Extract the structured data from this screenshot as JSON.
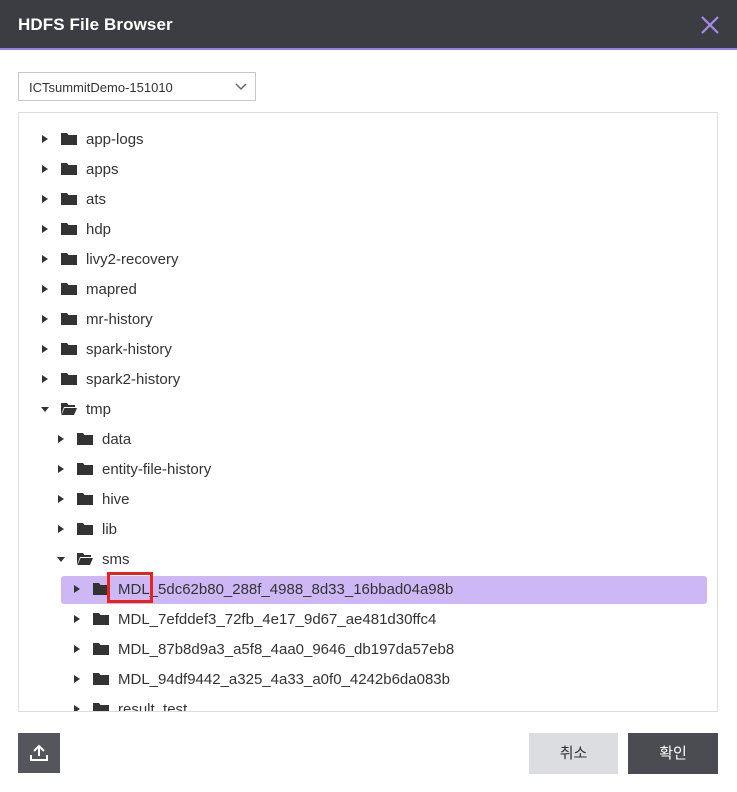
{
  "window": {
    "title": "HDFS File Browser"
  },
  "cluster_select": {
    "value": "ICTsummitDemo-151010"
  },
  "tree": {
    "items": [
      {
        "label": "app-logs",
        "depth": 0,
        "expanded": false,
        "selected": false
      },
      {
        "label": "apps",
        "depth": 0,
        "expanded": false,
        "selected": false
      },
      {
        "label": "ats",
        "depth": 0,
        "expanded": false,
        "selected": false
      },
      {
        "label": "hdp",
        "depth": 0,
        "expanded": false,
        "selected": false
      },
      {
        "label": "livy2-recovery",
        "depth": 0,
        "expanded": false,
        "selected": false
      },
      {
        "label": "mapred",
        "depth": 0,
        "expanded": false,
        "selected": false
      },
      {
        "label": "mr-history",
        "depth": 0,
        "expanded": false,
        "selected": false
      },
      {
        "label": "spark-history",
        "depth": 0,
        "expanded": false,
        "selected": false
      },
      {
        "label": "spark2-history",
        "depth": 0,
        "expanded": false,
        "selected": false
      },
      {
        "label": "tmp",
        "depth": 0,
        "expanded": true,
        "selected": false
      },
      {
        "label": "data",
        "depth": 1,
        "expanded": false,
        "selected": false
      },
      {
        "label": "entity-file-history",
        "depth": 1,
        "expanded": false,
        "selected": false
      },
      {
        "label": "hive",
        "depth": 1,
        "expanded": false,
        "selected": false
      },
      {
        "label": "lib",
        "depth": 1,
        "expanded": false,
        "selected": false
      },
      {
        "label": "sms",
        "depth": 1,
        "expanded": true,
        "selected": false
      },
      {
        "label": "MDL_5dc62b80_288f_4988_8d33_16bbad04a98b",
        "depth": 2,
        "expanded": false,
        "selected": true
      },
      {
        "label": "MDL_7efddef3_72fb_4e17_9d67_ae481d30ffc4",
        "depth": 2,
        "expanded": false,
        "selected": false
      },
      {
        "label": "MDL_87b8d9a3_a5f8_4aa0_9646_db197da57eb8",
        "depth": 2,
        "expanded": false,
        "selected": false
      },
      {
        "label": "MDL_94df9442_a325_4a33_a0f0_4242b6da083b",
        "depth": 2,
        "expanded": false,
        "selected": false
      },
      {
        "label": "result_test",
        "depth": 2,
        "expanded": false,
        "selected": false
      }
    ]
  },
  "footer": {
    "upload_icon": "upload-icon",
    "cancel_label": "취소",
    "ok_label": "확인"
  },
  "colors": {
    "titlebar": "#3c3d42",
    "accent": "#9b7ee0",
    "selection": "#cdb8f5",
    "marker": "#e8231e"
  }
}
